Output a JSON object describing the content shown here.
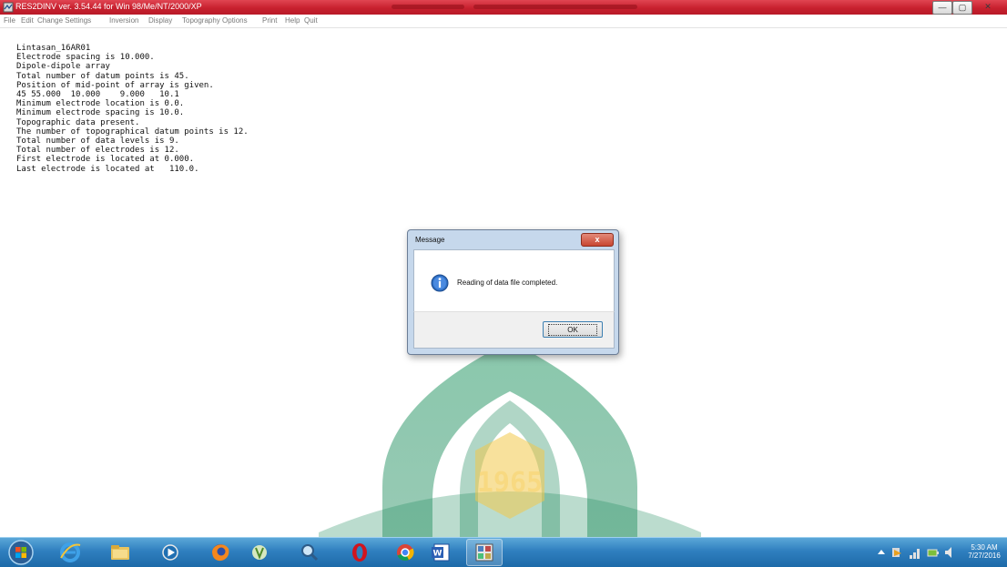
{
  "window": {
    "title": "RES2DINV ver. 3.54.44 for Win 98/Me/NT/2000/XP",
    "controls": {
      "minimize": "—",
      "maximize": "▢",
      "close": "✕"
    }
  },
  "menu": [
    "File",
    "Edit",
    "Change Settings",
    "Inversion",
    "Display",
    "Topography Options",
    "Print",
    "Help",
    "Quit"
  ],
  "output_lines": [
    "Lintasan_16AR01",
    "Electrode spacing is 10.000.",
    "Dipole-dipole array",
    "Total number of datum points is 45.",
    "Position of mid-point of array is given.",
    "45 55.000  10.000    9.000   10.1",
    "Minimum electrode location is 0.0.",
    "Minimum electrode spacing is 10.0.",
    "Topographic data present.",
    "The number of topographical datum points is 12.",
    "Total number of data levels is 9.",
    "Total number of electrodes is 12.",
    "First electrode is located at 0.000.",
    "Last electrode is located at   110.0."
  ],
  "dialog": {
    "title": "Message",
    "close_glyph": "x",
    "message": "Reading of data file completed.",
    "ok_label": "OK",
    "icon": "info-icon"
  },
  "watermark": {
    "text": "1965"
  },
  "taskbar": {
    "items": [
      "start-orb",
      "internet-explorer-icon",
      "file-explorer-icon",
      "media-player-icon",
      "firefox-icon",
      "app-icon",
      "magnifier-icon",
      "opera-icon",
      "chrome-icon",
      "word-icon",
      "res2dinv-icon"
    ],
    "clock_time": "5:30 AM",
    "clock_date": "7/27/2016"
  },
  "colors": {
    "titlebar": "#c8212f",
    "taskbar": "#2f7fbf",
    "watermark_green": "#1e8a5c",
    "watermark_gold": "#f3c84a"
  }
}
